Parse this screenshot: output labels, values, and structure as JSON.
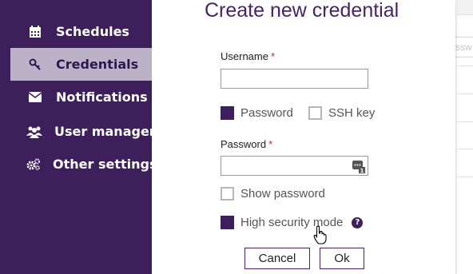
{
  "sidebar": {
    "items": [
      {
        "label": "Schedules",
        "icon": "calendar-icon"
      },
      {
        "label": "Credentials",
        "icon": "key-icon",
        "active": true
      },
      {
        "label": "Notifications",
        "icon": "envelope-icon"
      },
      {
        "label": "User managem",
        "icon": "users-icon"
      },
      {
        "label": "Other settings",
        "icon": "gears-icon"
      }
    ]
  },
  "background": {
    "input_fragment": "ssw"
  },
  "dialog": {
    "title": "Create new credential",
    "username_label": "Username",
    "username_value": "",
    "required_marker": "*",
    "auth_type": {
      "password_label": "Password",
      "password_selected": true,
      "ssh_label": "SSH key",
      "ssh_selected": false
    },
    "password_label": "Password",
    "password_value": "",
    "show_password_label": "Show password",
    "high_security_label": "High security mode",
    "help_glyph": "?",
    "cancel_label": "Cancel",
    "ok_label": "Ok"
  },
  "colors": {
    "sidebar_bg": "#3d1f5c",
    "sidebar_active_bg": "#bbb2c7",
    "accent": "#4a2268",
    "required": "#c62828"
  }
}
